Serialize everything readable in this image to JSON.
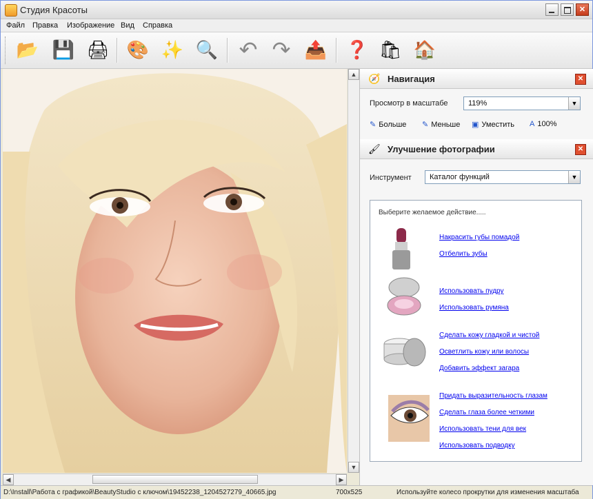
{
  "window": {
    "title": "Студия Красоты"
  },
  "menu": [
    "Файл",
    "Правка",
    "Изображение",
    "Вид",
    "Справка"
  ],
  "toolbar": {
    "buttons": [
      {
        "name": "open-icon",
        "glyph": "📂"
      },
      {
        "name": "save-icon",
        "glyph": "💾"
      },
      {
        "name": "print-icon",
        "glyph": "🖨"
      },
      {
        "name": "palette-icon",
        "glyph": "🎨"
      },
      {
        "name": "magic-wand-icon",
        "glyph": "✨"
      },
      {
        "name": "zoom-page-icon",
        "glyph": "🔍"
      },
      {
        "name": "undo-icon",
        "glyph": "↶"
      },
      {
        "name": "redo-icon",
        "glyph": "↷"
      },
      {
        "name": "export-icon",
        "glyph": "📤"
      },
      {
        "name": "help-icon",
        "glyph": "❓"
      },
      {
        "name": "shopping-bag-icon",
        "glyph": "🛍"
      },
      {
        "name": "home-icon",
        "glyph": "🏠"
      }
    ]
  },
  "navigation": {
    "title": "Навигация",
    "zoom_label": "Просмотр в масштабе",
    "zoom_value": "119%",
    "links": [
      "Больше",
      "Меньше",
      "Уместить",
      "100%"
    ]
  },
  "enhance": {
    "title": "Улучшение фотографии",
    "tool_label": "Инструмент",
    "tool_value": "Каталог функций",
    "hint": "Выберите желаемое действие.....",
    "groups": [
      {
        "icon": "lipstick-icon",
        "links": [
          "Накрасить губы помадой",
          "Отбелить зубы"
        ]
      },
      {
        "icon": "powder-compact-icon",
        "links": [
          "Использовать пудру",
          "Использовать румяна"
        ]
      },
      {
        "icon": "cream-jar-icon",
        "links": [
          "Сделать кожу гладкой и чистой",
          "Осветлить кожу или волосы",
          "Добавить эффект загара"
        ]
      },
      {
        "icon": "eye-makeup-icon",
        "links": [
          "Придать выразительность глазам",
          "Сделать глаза более четкими",
          "Использовать тени для век",
          "Использовать подводку"
        ]
      }
    ]
  },
  "status": {
    "path": "D:\\Install\\Работа с графикой\\BeautyStudio с ключом\\19452238_1204527279_40665.jpg",
    "size": "700x525",
    "hint": "Используйте колесо прокрутки для изменения масштаба"
  },
  "colors": {
    "link": "#0000ee",
    "title_bar": "#dcdcdc",
    "close": "#e05030"
  }
}
